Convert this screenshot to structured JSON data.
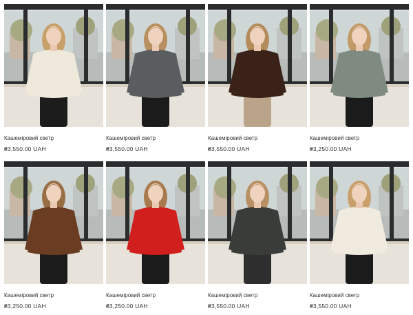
{
  "products": [
    {
      "name": "Кашеміровий светр",
      "price": "₴3,550.00 UAH",
      "sweater_color": "#efe9dc",
      "pants_color": "#1c1c1c",
      "hair_color": "#c7a06a",
      "scene": "cafe-window"
    },
    {
      "name": "Кашеміровий светр",
      "price": "₴3,550.00 UAH",
      "sweater_color": "#5a5d60",
      "pants_color": "#1b1b1b",
      "hair_color": "#b88f5e",
      "scene": "cafe-window"
    },
    {
      "name": "Кашеміровий светр",
      "price": "₴3,550.00 UAH",
      "sweater_color": "#3a2219",
      "pants_color": "#b9a48a",
      "hair_color": "#b48c5c",
      "scene": "cafe-window"
    },
    {
      "name": "Кашеміровий светр",
      "price": "₴3,250.00 UAH",
      "sweater_color": "#7f8a80",
      "pants_color": "#1b1b1b",
      "hair_color": "#c19a67",
      "scene": "cafe-window"
    },
    {
      "name": "Кашеміровий светр",
      "price": "₴3,250.00 UAH",
      "sweater_color": "#6a3d22",
      "pants_color": "#1b1b1b",
      "hair_color": "#9a6e45",
      "scene": "cafe-window"
    },
    {
      "name": "Кашеміровий светр",
      "price": "₴3,250.00 UAH",
      "sweater_color": "#d01f1d",
      "pants_color": "#1b1b1b",
      "hair_color": "#a7794c",
      "scene": "cafe-window"
    },
    {
      "name": "Кашеміровий светр",
      "price": "₴3,550.00 UAH",
      "sweater_color": "#3a3c3a",
      "pants_color": "#2e2e2e",
      "hair_color": "#b89064",
      "scene": "cafe-window"
    },
    {
      "name": "Кашеміровий светр",
      "price": "₴3,550.00 UAH",
      "sweater_color": "#f1ebdf",
      "pants_color": "#1b1b1b",
      "hair_color": "#c9a06b",
      "scene": "cafe-window"
    }
  ]
}
